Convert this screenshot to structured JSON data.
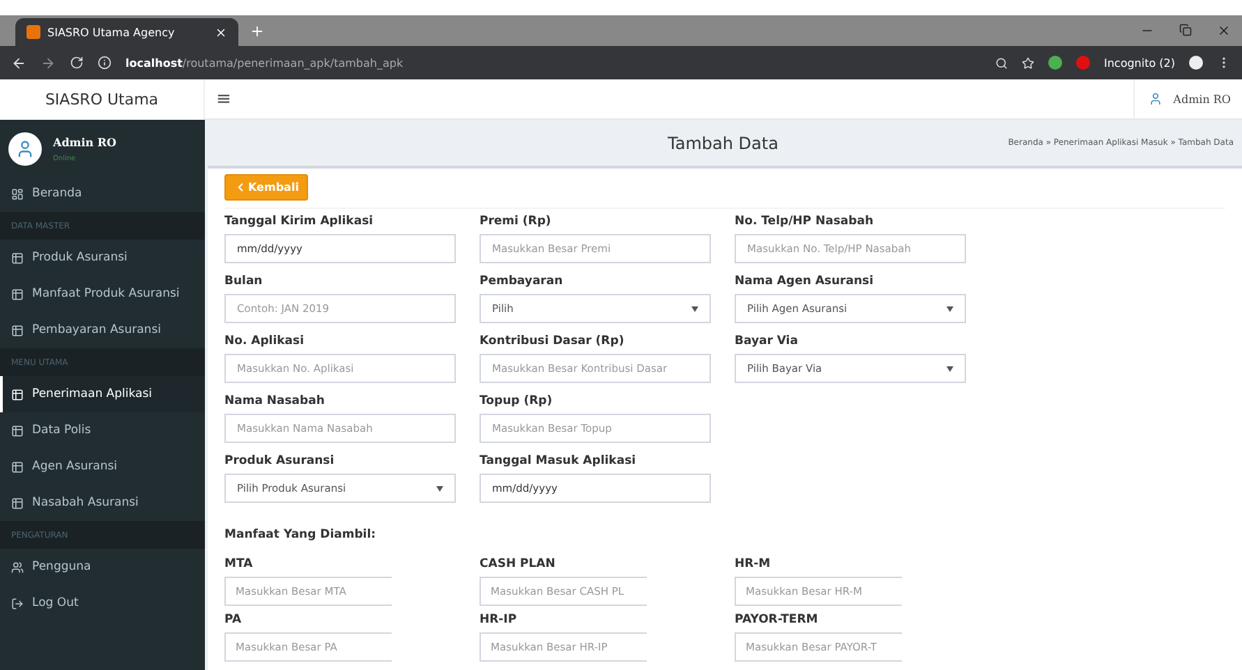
{
  "browser": {
    "tab_title": "SIASRO Utama Agency",
    "url": "**localhost**/routama/penerimaan_apk/tambah_apk",
    "profile": "Incognito (2)"
  },
  "app": {
    "brand": "SIASRO Utama",
    "menu_toggle": "≡",
    "user": "Admin RO"
  },
  "sidebar": {
    "user": {
      "name": "Admin RO",
      "status": "Online"
    },
    "items": [
      {
        "kind": "dashboard",
        "label": "Beranda",
        "selected": false
      },
      {
        "kind": "header",
        "label": "DATA MASTER"
      },
      {
        "kind": "table",
        "label": "Produk Asuransi",
        "selected": false
      },
      {
        "kind": "table",
        "label": "Manfaat Produk Asuransi",
        "selected": false
      },
      {
        "kind": "table",
        "label": "Pembayaran Asuransi",
        "selected": false
      },
      {
        "kind": "header",
        "label": "MENU UTAMA"
      },
      {
        "kind": "table",
        "label": "Penerimaan Aplikasi",
        "selected": true
      },
      {
        "kind": "table",
        "label": "Data Polis",
        "selected": false
      },
      {
        "kind": "table",
        "label": "Agen Asuransi",
        "selected": false
      },
      {
        "kind": "table",
        "label": "Nasabah Asuransi",
        "selected": false
      },
      {
        "kind": "header",
        "label": "PENGATURAN"
      },
      {
        "kind": "users",
        "label": "Pengguna",
        "selected": false
      },
      {
        "kind": "logout",
        "label": "Log Out",
        "selected": false
      }
    ]
  },
  "page": {
    "title": "Tambah Data",
    "breadcrumb": "Beranda » Penerimaan Aplikasi Masuk » Tambah Data",
    "back_button": "Kembali"
  },
  "form": {
    "rows": [
      [
        {
          "kind": "date",
          "label": "Tanggal Kirim Aplikasi",
          "value": "mm/dd/yyyy"
        },
        {
          "kind": "text",
          "label": "Premi (Rp)",
          "placeholder": "Masukkan Besar Premi"
        },
        {
          "kind": "text",
          "label": "No. Telp/HP Nasabah",
          "placeholder": "Masukkan No. Telp/HP Nasabah"
        }
      ],
      [
        {
          "kind": "text",
          "label": "Bulan",
          "placeholder": "Contoh: JAN 2019"
        },
        {
          "kind": "select",
          "label": "Pembayaran",
          "value": "Pilih"
        },
        {
          "kind": "select",
          "label": "Nama Agen Asuransi",
          "value": "Pilih Agen Asuransi"
        }
      ],
      [
        {
          "kind": "text",
          "label": "No. Aplikasi",
          "placeholder": "Masukkan No. Aplikasi"
        },
        {
          "kind": "text",
          "label": "Kontribusi Dasar (Rp)",
          "placeholder": "Masukkan Besar Kontribusi Dasar"
        },
        {
          "kind": "select",
          "label": "Bayar Via",
          "value": "Pilih Bayar Via"
        }
      ],
      [
        {
          "kind": "text",
          "label": "Nama Nasabah",
          "placeholder": "Masukkan Nama Nasabah"
        },
        {
          "kind": "text",
          "label": "Topup (Rp)",
          "placeholder": "Masukkan Besar Topup"
        }
      ],
      [
        {
          "kind": "select",
          "label": "Produk Asuransi",
          "value": "Pilih Produk Asuransi"
        },
        {
          "kind": "date",
          "label": "Tanggal Masuk Aplikasi",
          "value": "mm/dd/yyyy"
        }
      ]
    ],
    "benefits_title": "Manfaat Yang Diambil:",
    "benefits": [
      [
        {
          "label": "MTA",
          "placeholder": "Masukkan Besar MTA"
        },
        {
          "label": "CASH PLAN",
          "placeholder": "Masukkan Besar CASH PL"
        },
        {
          "label": "HR-M",
          "placeholder": "Masukkan Besar HR-M"
        }
      ],
      [
        {
          "label": "PA",
          "placeholder": "Masukkan Besar PA"
        },
        {
          "label": "HR-IP",
          "placeholder": "Masukkan Besar HR-IP"
        },
        {
          "label": "PAYOR-TERM",
          "placeholder": "Masukkan Besar PAYOR-T"
        }
      ]
    ]
  }
}
